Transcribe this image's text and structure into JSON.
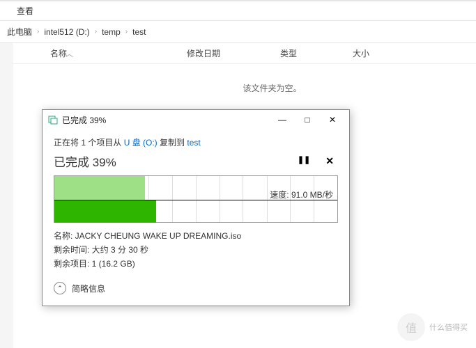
{
  "menu": {
    "view": "查看"
  },
  "breadcrumb": {
    "root": "此电脑",
    "p1": "intel512 (D:)",
    "p2": "temp",
    "p3": "test"
  },
  "columns": {
    "name": "名称",
    "date": "修改日期",
    "type": "类型",
    "size": "大小"
  },
  "content": {
    "empty": "该文件夹为空。"
  },
  "dialog": {
    "title": "已完成 39%",
    "status_prefix": "正在将 1 个项目从 ",
    "source": "U 盘 (O:)",
    "status_mid": " 复制到 ",
    "dest": "test",
    "progress_label": "已完成 39%",
    "speed_label": "速度: 91.0 MB/秒",
    "pause": "❚❚",
    "cancel": "✕",
    "name_row": "名称: JACKY CHEUNG WAKE UP DREAMING.iso",
    "eta_row": "剩余时间: 大约 3 分 30 秒",
    "remain_row": "剩余项目: 1 (16.2 GB)",
    "more": "简略信息",
    "more_icon": "⌃",
    "fill_top_pct": 32,
    "fill_bot_pct": 36
  },
  "watermark": {
    "logo": "值",
    "text": "什么值得买"
  },
  "win": {
    "min": "—",
    "max": "□",
    "close": "✕"
  }
}
